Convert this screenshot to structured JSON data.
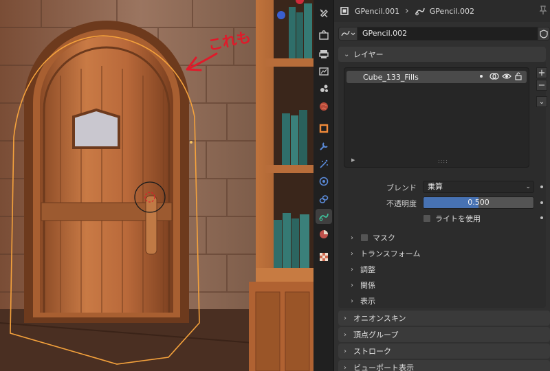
{
  "breadcrumb": {
    "object_name": "GPencil.001",
    "data_name": "GPencil.002"
  },
  "data_block": {
    "name": "GPencil.002"
  },
  "annotation": {
    "text": "これも",
    "color": "#e01a2a"
  },
  "layers_panel": {
    "title": "レイヤー",
    "layers": [
      {
        "name": "Cube_133_Fills"
      }
    ],
    "blend_label": "ブレンド",
    "blend_value": "乗算",
    "opacity_label": "不透明度",
    "opacity_value": "0.500",
    "opacity_fraction": 0.5,
    "use_lights_label": "ライトを使用",
    "use_lights_checked": false,
    "subpanels": [
      {
        "label": "マスク",
        "has_checkbox": true
      },
      {
        "label": "トランスフォーム"
      },
      {
        "label": "調整"
      },
      {
        "label": "関係"
      },
      {
        "label": "表示"
      }
    ]
  },
  "other_panels": [
    {
      "label": "オニオンスキン"
    },
    {
      "label": "頂点グループ"
    },
    {
      "label": "ストローク"
    },
    {
      "label": "ビューポート表示"
    }
  ],
  "colors": {
    "accent": "#4772b3",
    "selection_outline": "#f5a23c",
    "active_tab": "#3f3f3f"
  },
  "tab_icons": [
    "tool-icon",
    "render-icon",
    "output-icon",
    "view-layer-icon",
    "scene-icon",
    "world-icon",
    "object-icon",
    "modifier-icon",
    "particles-icon",
    "physics-icon",
    "constraints-icon",
    "gpencil-data-icon",
    "material-icon",
    "texture-icon"
  ]
}
